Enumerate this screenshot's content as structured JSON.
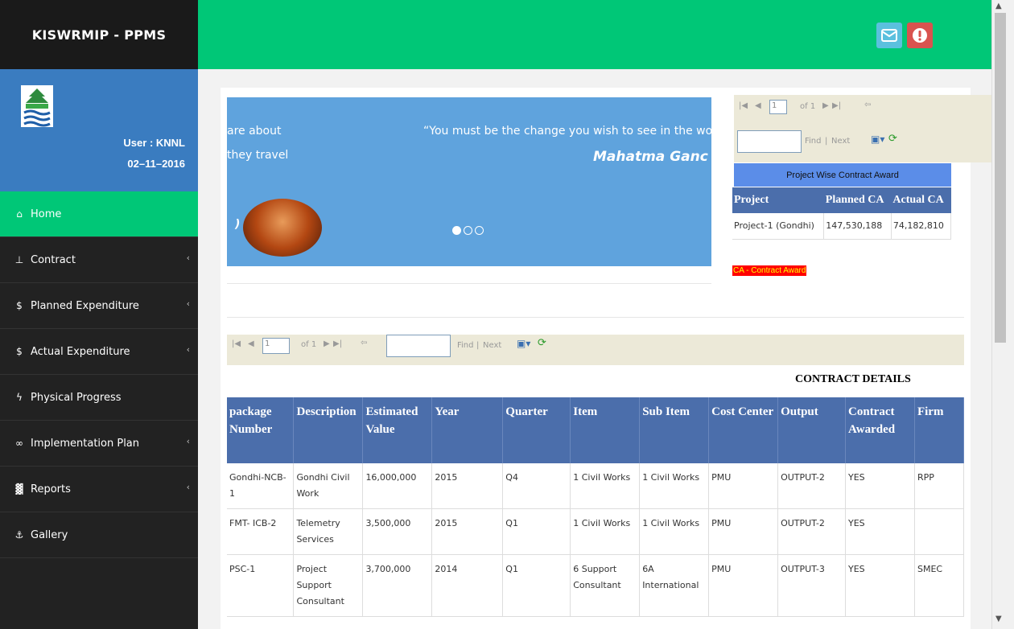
{
  "brand": "KISWRMIP - PPMS",
  "user": {
    "name": "User : KNNL",
    "date": "02–11–2016"
  },
  "nav": [
    {
      "icon": "home-icon",
      "glyph": "⌂",
      "label": "Home",
      "active": true,
      "chevron": false
    },
    {
      "icon": "thumbtack-icon",
      "glyph": "⊥",
      "label": "Contract",
      "active": false,
      "chevron": true
    },
    {
      "icon": "dollar-icon",
      "glyph": "$",
      "label": "Planned Expenditure",
      "active": false,
      "chevron": true
    },
    {
      "icon": "dollar-icon",
      "glyph": "$",
      "label": "Actual Expenditure",
      "active": false,
      "chevron": true
    },
    {
      "icon": "bolt-icon",
      "glyph": "ϟ",
      "label": "Physical Progress",
      "active": false,
      "chevron": false
    },
    {
      "icon": "bicycle-icon",
      "glyph": "∞",
      "label": "Implementation Plan",
      "active": false,
      "chevron": true
    },
    {
      "icon": "grid-icon",
      "glyph": "▓",
      "label": "Reports",
      "active": false,
      "chevron": true
    },
    {
      "icon": "anchor-icon",
      "glyph": "⚓",
      "label": "Gallery",
      "active": false,
      "chevron": false
    }
  ],
  "carousel": {
    "text_left_1": "are about",
    "text_left_2": "they travel",
    "quote": "“You must be the change you wish to see in the worl",
    "author": "Mahatma Ganc",
    "fragment": ")"
  },
  "report_toolbar": {
    "page": "1",
    "of": "of 1",
    "find": "Find",
    "separator": "|",
    "next": "Next"
  },
  "contract_award": {
    "title": "Project Wise Contract Award",
    "headers": [
      "Project",
      "Planned CA",
      "Actual CA"
    ],
    "rows": [
      {
        "project": "Project-1 (Gondhi)",
        "planned": "147,530,188",
        "actual": "74,182,810"
      }
    ],
    "note": "CA - Contract Award"
  },
  "contract_details": {
    "title": "CONTRACT DETAILS",
    "headers": [
      "package Number",
      "Description",
      "Estimated Value",
      "Year",
      "Quarter",
      "Item",
      "Sub Item",
      "Cost Center",
      "Output",
      "Contract Awarded",
      "Firm"
    ],
    "rows": [
      [
        "Gondhi-NCB-1",
        "Gondhi Civil Work",
        "16,000,000",
        "2015",
        "Q4",
        "1 Civil Works",
        "1 Civil Works",
        "PMU",
        "OUTPUT-2",
        "YES",
        "RPP"
      ],
      [
        "FMT- ICB-2",
        "Telemetry Services",
        "3,500,000",
        "2015",
        "Q1",
        "1 Civil Works",
        "1 Civil Works",
        "PMU",
        "OUTPUT-2",
        "YES",
        ""
      ],
      [
        "PSC-1",
        "Project Support Consultant",
        "3,700,000",
        "2014",
        "Q1",
        "6 Support Consultant",
        "6A International",
        "PMU",
        "OUTPUT-3",
        "YES",
        "SMEC"
      ]
    ]
  },
  "colors": {
    "accent_green": "#00c777",
    "sidebar_dark": "#222222",
    "user_panel_blue": "#3a7cc0",
    "table_header_blue": "#4b6eab",
    "mail_button": "#5bc0de",
    "alert_button": "#d9534f"
  }
}
